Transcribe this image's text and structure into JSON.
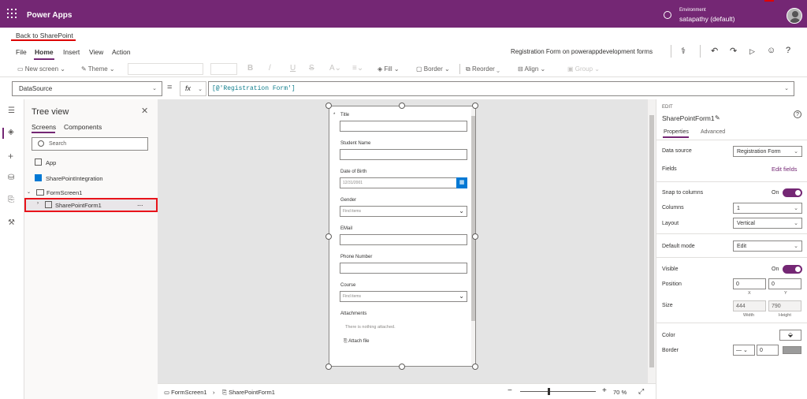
{
  "app": {
    "name": "Power Apps",
    "env_label": "Environment",
    "env_name": "satapathy (default)"
  },
  "back_link": "Back to SharePoint",
  "menu": {
    "items": [
      "File",
      "Home",
      "Insert",
      "View",
      "Action"
    ],
    "doc_title": "Registration Form on powerappdevelopment forms"
  },
  "ribbon": {
    "new_screen": "New screen",
    "theme": "Theme",
    "fill": "Fill",
    "border": "Border",
    "reorder": "Reorder",
    "align": "Align",
    "group": "Group"
  },
  "formula_bar": {
    "property": "DataSource",
    "eq": "=",
    "fx": "fx",
    "formula": "[@'Registration Form']"
  },
  "tree": {
    "title": "Tree view",
    "tabs": [
      "Screens",
      "Components"
    ],
    "search_placeholder": "Search",
    "items": {
      "app": "App",
      "integration": "SharePointIntegration",
      "screen": "FormScreen1",
      "form": "SharePointForm1",
      "more": "..."
    }
  },
  "form": {
    "fields": [
      {
        "label": "Title",
        "required": "*",
        "value": ""
      },
      {
        "label": "Student Name",
        "value": ""
      },
      {
        "label": "Date of Birth",
        "value": "12/31/2001"
      },
      {
        "label": "Gender",
        "value": "Find items"
      },
      {
        "label": "EMail",
        "value": ""
      },
      {
        "label": "Phone Number",
        "value": ""
      },
      {
        "label": "Course",
        "value": "Find items"
      }
    ],
    "attachments_label": "Attachments",
    "attachments_empty": "There is nothing attached.",
    "attach_file": "Attach file"
  },
  "statusbar": {
    "screen": "FormScreen1",
    "form": "SharePointForm1",
    "minus": "−",
    "plus": "+",
    "zoom_value": "70",
    "zoom_unit": "%"
  },
  "props": {
    "edit_label": "EDIT",
    "control_name": "SharePointForm1",
    "tabs": [
      "Properties",
      "Advanced"
    ],
    "data_source_label": "Data source",
    "data_source_value": "Registration Form",
    "fields_label": "Fields",
    "edit_fields": "Edit fields",
    "snap_label": "Snap to columns",
    "snap_state": "On",
    "columns_label": "Columns",
    "columns_value": "1",
    "layout_label": "Layout",
    "layout_value": "Vertical",
    "default_mode_label": "Default mode",
    "default_mode_value": "Edit",
    "visible_label": "Visible",
    "visible_state": "On",
    "position_label": "Position",
    "x_value": "0",
    "y_value": "0",
    "x_sub": "X",
    "y_sub": "Y",
    "size_label": "Size",
    "width_value": "444",
    "height_value": "790",
    "width_sub": "Width",
    "height_sub": "Height",
    "color_label": "Color",
    "border_label": "Border",
    "border_width": "0"
  },
  "colors": {
    "brand": "#742774",
    "highlight": "#e8141b",
    "accent": "#0078d4"
  }
}
